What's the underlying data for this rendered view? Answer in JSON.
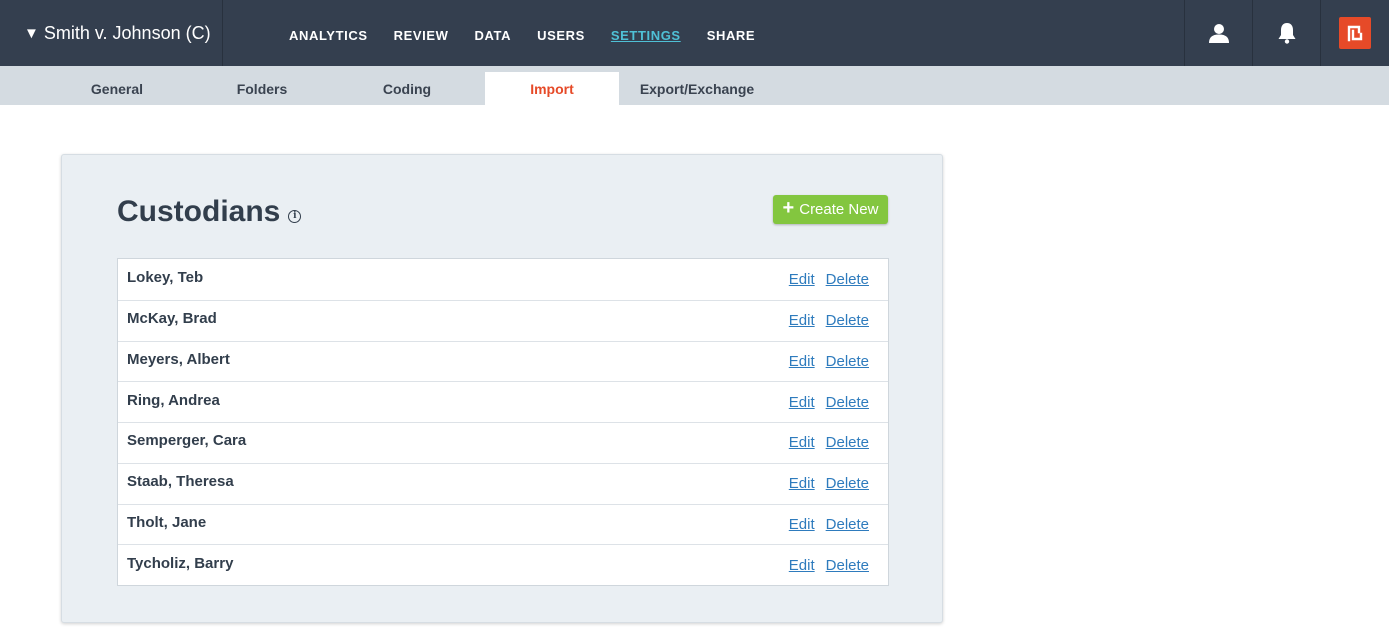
{
  "header": {
    "case_caret": "▼",
    "case_name": "Smith v. Johnson (C)",
    "nav": [
      {
        "label": "ANALYTICS"
      },
      {
        "label": "REVIEW"
      },
      {
        "label": "DATA"
      },
      {
        "label": "USERS"
      },
      {
        "label": "SETTINGS",
        "active": true
      },
      {
        "label": "SHARE"
      }
    ],
    "icons": [
      "user-icon",
      "bell-icon",
      "brand-logo-icon"
    ],
    "brand_color": "#e64a28"
  },
  "subtabs": [
    {
      "label": "General"
    },
    {
      "label": "Folders"
    },
    {
      "label": "Coding"
    },
    {
      "label": "Import",
      "active": true
    },
    {
      "label": "Export/Exchange"
    }
  ],
  "panel": {
    "title": "Custodians",
    "info_glyph": "i",
    "create_label": "Create New",
    "create_color": "#83c63f",
    "link_color": "#2e7bbd"
  },
  "custodians": [
    {
      "name": "Lokey, Teb",
      "edit": "Edit",
      "delete": "Delete"
    },
    {
      "name": "McKay, Brad",
      "edit": "Edit",
      "delete": "Delete"
    },
    {
      "name": "Meyers, Albert",
      "edit": "Edit",
      "delete": "Delete"
    },
    {
      "name": "Ring, Andrea",
      "edit": "Edit",
      "delete": "Delete"
    },
    {
      "name": "Semperger, Cara",
      "edit": "Edit",
      "delete": "Delete"
    },
    {
      "name": "Staab, Theresa",
      "edit": "Edit",
      "delete": "Delete"
    },
    {
      "name": "Tholt, Jane",
      "edit": "Edit",
      "delete": "Delete"
    },
    {
      "name": "Tycholiz, Barry",
      "edit": "Edit",
      "delete": "Delete"
    }
  ]
}
